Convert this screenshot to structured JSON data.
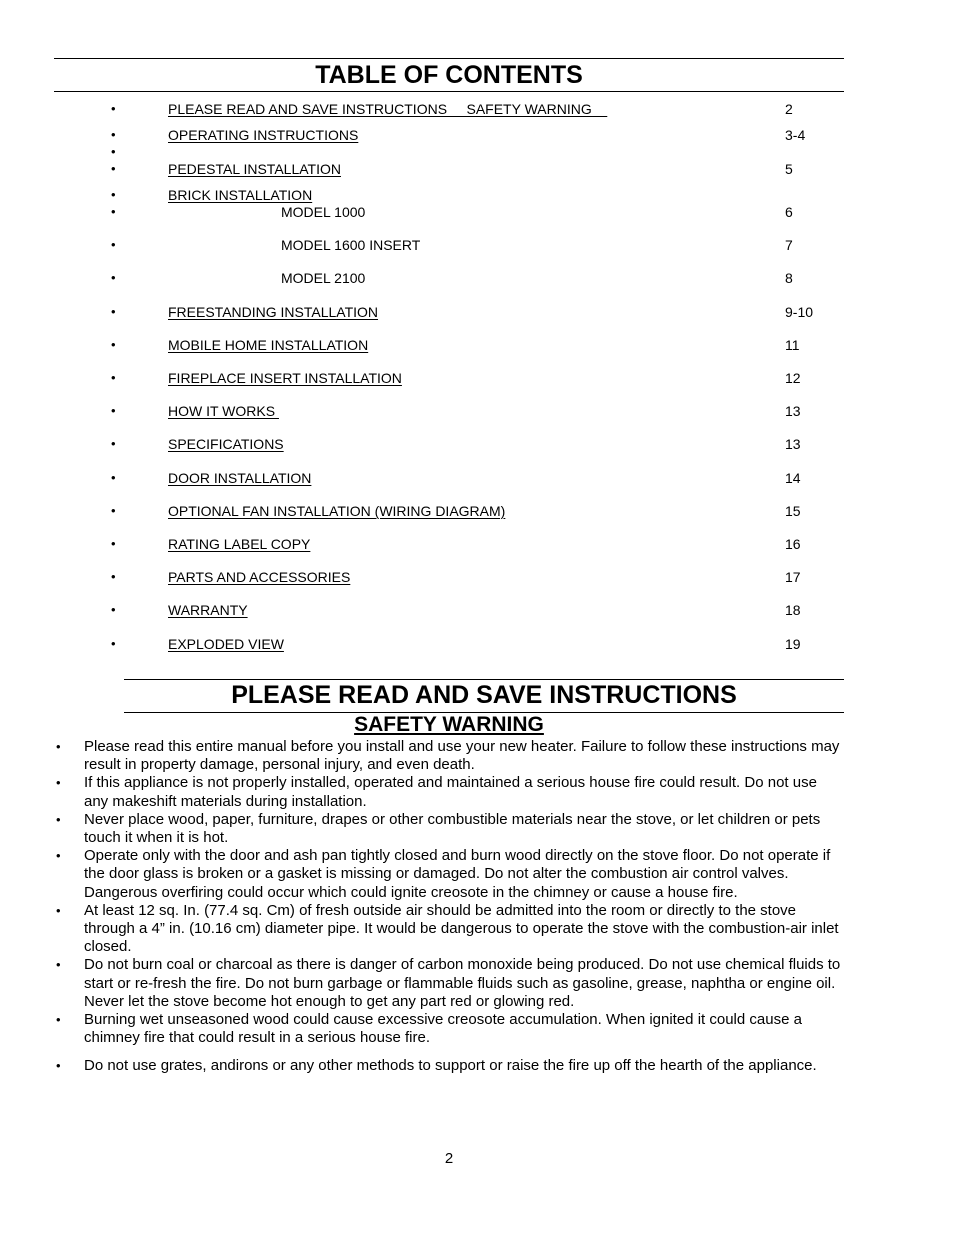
{
  "toc": {
    "title": "TABLE OF CONTENTS",
    "bullet_icon": "•",
    "entries": [
      {
        "label": "PLEASE READ AND SAVE INSTRUCTIONS     SAFETY WARNING    ",
        "page": "2",
        "sub": false
      },
      {
        "label": "OPERATING INSTRUCTIONS",
        "page": "3-4",
        "sub": false
      },
      {
        "label": "",
        "page": "",
        "sub": false
      },
      {
        "label": "PEDESTAL INSTALLATION",
        "page": "5",
        "sub": false
      },
      {
        "label": "BRICK INSTALLATION",
        "page": "",
        "sub": false
      },
      {
        "label": "MODEL 1000",
        "page": "6",
        "sub": true
      },
      {
        "label": "MODEL 1600 INSERT",
        "page": "7",
        "sub": true
      },
      {
        "label": "MODEL 2100",
        "page": "8",
        "sub": true
      },
      {
        "label": "FREESTANDING INSTALLATION",
        "page": "9-10",
        "sub": false
      },
      {
        "label": "MOBILE HOME INSTALLATION",
        "page": "11",
        "sub": false
      },
      {
        "label": "FIREPLACE INSERT INSTALLATION",
        "page": "12",
        "sub": false
      },
      {
        "label": "HOW IT WORKS ",
        "page": "13",
        "sub": false
      },
      {
        "label": "SPECIFICATIONS",
        "page": "13",
        "sub": false
      },
      {
        "label": "DOOR INSTALLATION",
        "page": "14",
        "sub": false
      },
      {
        "label": "OPTIONAL FAN INSTALLATION (WIRING DIAGRAM)",
        "page": "15",
        "sub": false
      },
      {
        "label": "RATING LABEL COPY",
        "page": "16",
        "sub": false
      },
      {
        "label": "PARTS AND ACCESSORIES",
        "page": "17",
        "sub": false
      },
      {
        "label": "WARRANTY",
        "page": "18",
        "sub": false
      },
      {
        "label": "EXPLODED VIEW",
        "page": "19",
        "sub": false
      }
    ]
  },
  "instructions": {
    "title": "PLEASE READ AND SAVE INSTRUCTIONS",
    "subtitle": "SAFETY WARNING",
    "bullet_icon": "•",
    "warnings": [
      "Please read this entire manual before you install and use your new heater. Failure to follow these instructions may result in property damage, personal injury, and even death.",
      "If this appliance is not properly installed, operated and maintained a serious house fire could result. Do not use any makeshift materials during installation.",
      "Never place wood, paper, furniture, drapes or other combustible materials near the stove, or let children or pets touch it when it is hot.",
      "Operate only with the door and ash pan tightly closed and burn wood directly on the stove floor. Do not operate if the door glass is broken or a gasket is missing or damaged. Do not alter the combustion air control valves. Dangerous overfiring could occur which could ignite creosote in the chimney or cause a house fire.",
      "At least 12 sq. In. (77.4 sq. Cm) of fresh outside air should be admitted into the room or directly to the stove through a 4” in. (10.16 cm) diameter pipe. It would be dangerous to operate the stove with the combustion-air inlet closed.",
      "Do not burn coal or charcoal as there is danger of carbon monoxide being produced. Do not use chemical fluids to start or re-fresh the fire. Do not burn garbage or flammable fluids such as gasoline, grease, naphtha or engine oil. Never let the stove become hot enough to get any part red or glowing red.",
      "Burning wet unseasoned wood could cause excessive creosote accumulation. When ignited it could cause a chimney fire that could result in a serious house fire.",
      "Do not use grates, andirons or any other methods to support or raise the fire up off the hearth of the appliance."
    ]
  },
  "footer": {
    "page_number": "2"
  }
}
